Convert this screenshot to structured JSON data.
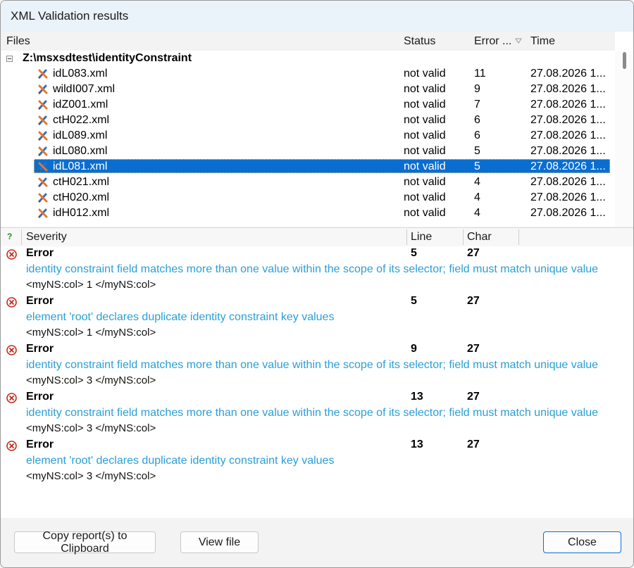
{
  "window": {
    "title": "XML Validation results"
  },
  "files": {
    "columns": {
      "files": "Files",
      "status": "Status",
      "errors": "Error ...",
      "time": "Time"
    },
    "root_folder": "Z:\\msxsdtest\\identityConstraint",
    "rows": [
      {
        "name": "idL083.xml",
        "status": "not valid",
        "errors": "11",
        "time": "27.08.2026 1...",
        "selected": false
      },
      {
        "name": "wildI007.xml",
        "status": "not valid",
        "errors": "9",
        "time": "27.08.2026 1...",
        "selected": false
      },
      {
        "name": "idZ001.xml",
        "status": "not valid",
        "errors": "7",
        "time": "27.08.2026 1...",
        "selected": false
      },
      {
        "name": "ctH022.xml",
        "status": "not valid",
        "errors": "6",
        "time": "27.08.2026 1...",
        "selected": false
      },
      {
        "name": "idL089.xml",
        "status": "not valid",
        "errors": "6",
        "time": "27.08.2026 1...",
        "selected": false
      },
      {
        "name": "idL080.xml",
        "status": "not valid",
        "errors": "5",
        "time": "27.08.2026 1...",
        "selected": false
      },
      {
        "name": "idL081.xml",
        "status": "not valid",
        "errors": "5",
        "time": "27.08.2026 1...",
        "selected": true
      },
      {
        "name": "ctH021.xml",
        "status": "not valid",
        "errors": "4",
        "time": "27.08.2026 1...",
        "selected": false
      },
      {
        "name": "ctH020.xml",
        "status": "not valid",
        "errors": "4",
        "time": "27.08.2026 1...",
        "selected": false
      },
      {
        "name": "idH012.xml",
        "status": "not valid",
        "errors": "4",
        "time": "27.08.2026 1...",
        "selected": false
      }
    ]
  },
  "messages": {
    "columns": {
      "help": "?",
      "severity": "Severity",
      "line": "Line",
      "char": "Char"
    },
    "items": [
      {
        "severity": "Error",
        "line": "5",
        "char": "27",
        "text": "identity constraint field matches more than one value within the scope of its selector; field must match unique value",
        "code": "<myNS:col> 1 </myNS:col>"
      },
      {
        "severity": "Error",
        "line": "5",
        "char": "27",
        "text": "element 'root' declares duplicate identity constraint key values",
        "code": "<myNS:col> 1 </myNS:col>"
      },
      {
        "severity": "Error",
        "line": "9",
        "char": "27",
        "text": "identity constraint field matches more than one value within the scope of its selector; field must match unique value",
        "code": "<myNS:col> 3 </myNS:col>"
      },
      {
        "severity": "Error",
        "line": "13",
        "char": "27",
        "text": "identity constraint field matches more than one value within the scope of its selector; field must match unique value",
        "code": "<myNS:col> 3 </myNS:col>"
      },
      {
        "severity": "Error",
        "line": "13",
        "char": "27",
        "text": "element 'root' declares duplicate identity constraint key values",
        "code": "<myNS:col> 3 </myNS:col>"
      }
    ]
  },
  "buttons": {
    "copy": "Copy report(s) to Clipboard",
    "view": "View file",
    "close": "Close"
  },
  "icons": {
    "file": "invalid-xml-file-icon",
    "error": "error-circle-icon",
    "collapse": "tree-collapse-icon",
    "sort": "sort-indicator-icon",
    "help": "help-icon"
  },
  "colors": {
    "selection": "#0a6ed1",
    "message_text": "#2a9fd6",
    "error_icon": "#c42b1c"
  }
}
